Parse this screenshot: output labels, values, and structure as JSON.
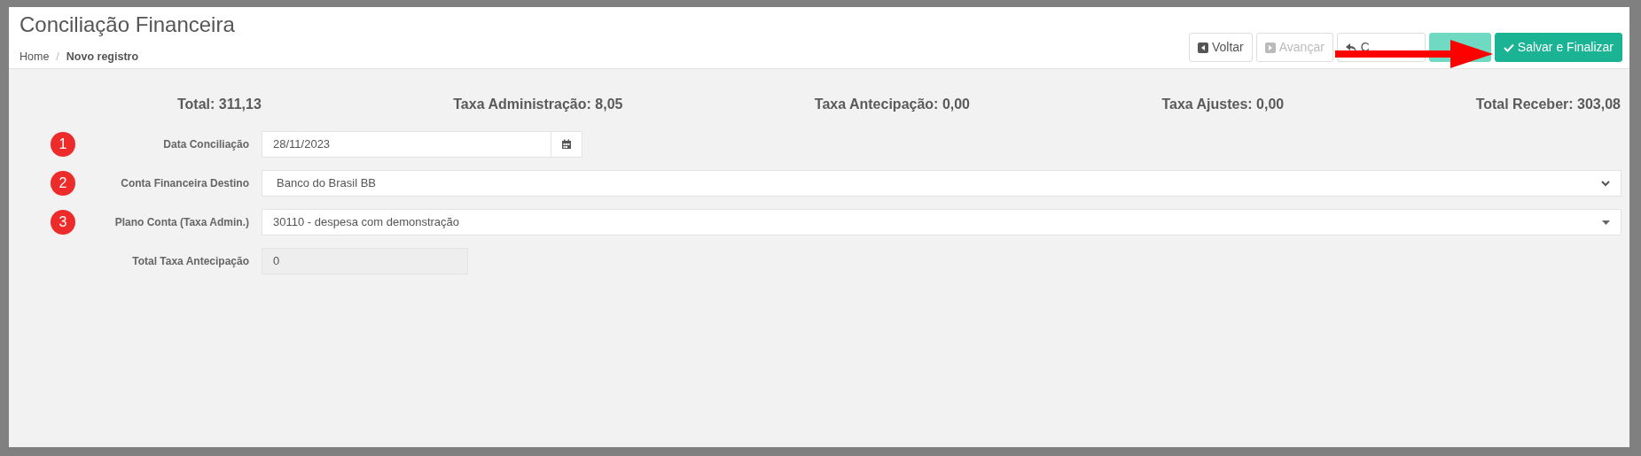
{
  "header": {
    "title": "Conciliação Financeira",
    "breadcrumb": [
      {
        "label": "Home",
        "current": false
      },
      {
        "label": "Novo registro",
        "current": true
      }
    ],
    "breadcrumb_separator": "/",
    "buttons": [
      {
        "kind": "back",
        "label": "Voltar",
        "disabled": false
      },
      {
        "kind": "forward",
        "label": "Avançar",
        "disabled": true
      },
      {
        "kind": "undo",
        "label": "C",
        "disabled": false
      },
      {
        "kind": "confirm",
        "disabled": true
      },
      {
        "kind": "confirm",
        "label": "Salvar e Finalizar",
        "disabled": false
      }
    ]
  },
  "summary": [
    "Total: 311,13",
    "Taxa Administração: 8,05",
    "Taxa Antecipação: 0,00",
    "Taxa Ajustes: 0,00",
    "Total Receber: 303,08"
  ],
  "form": [
    {
      "kind": "date",
      "label": "Data Conciliação",
      "marker": "1",
      "value": "28/11/2023",
      "disabled": false
    },
    {
      "kind": "select",
      "label": "Conta Financeira Destino",
      "marker": "2",
      "value": "Banco do Brasil BB",
      "disabled": false
    },
    {
      "kind": "combo",
      "label": "Plano Conta (Taxa Admin.)",
      "marker": "3",
      "value": "30110 - despesa com demonstração",
      "disabled": false
    },
    {
      "kind": "text",
      "label": "Total Taxa Antecipação",
      "value": "0",
      "disabled": true
    }
  ]
}
